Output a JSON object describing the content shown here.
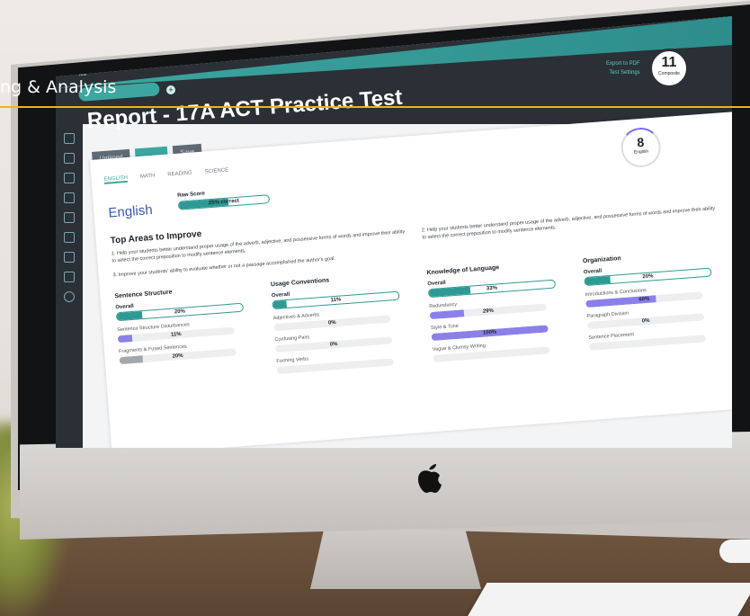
{
  "overlay": {
    "title": "ng & Analysis"
  },
  "app": {
    "test_label": "Test",
    "report_title": "Report - 17A ACT Practice Test",
    "buttons": [
      "Untimed",
      "",
      "Save"
    ],
    "export_pdf": "Export to PDF",
    "test_settings": "Test Settings",
    "composite": {
      "value": "11",
      "label": "Composite"
    }
  },
  "tabs": [
    "ENGLISH",
    "MATH",
    "READING",
    "SCIENCE"
  ],
  "section": {
    "title": "English",
    "score": {
      "value": "8",
      "label": "English"
    },
    "raw_score_label": "Raw Score",
    "raw_score_pct": "25% correct",
    "raw_score_fraction": 0.25
  },
  "top_areas": {
    "title": "Top Areas to Improve",
    "items": [
      "1. Help your students better understand proper usage of the adverb, adjective, and possessive forms of words and improve their ability to select the correct preposition to modify sentence elements.",
      "2. Help your students better understand proper usage of the adverb, adjective, and possessive forms of words and improve their ability to select the correct preposition to modify sentence elements.",
      "3. Improve your students' ability to evaluate whether or not a passage accomplished the author's goal."
    ]
  },
  "categories": [
    {
      "title": "Sentence Structure",
      "overall_label": "Overall",
      "overall": "20%",
      "overall_fraction": 0.2,
      "items": [
        {
          "label": "Sentence Structure Disturbances",
          "value": "11%",
          "fraction": 0.11,
          "tone": "purple"
        },
        {
          "label": "Fragments & Fused Sentences",
          "value": "20%",
          "fraction": 0.2,
          "tone": "grey"
        }
      ]
    },
    {
      "title": "Usage Conventions",
      "overall_label": "Overall",
      "overall": "11%",
      "overall_fraction": 0.11,
      "items": [
        {
          "label": "Adjectives & Adverbs",
          "value": "0%",
          "fraction": 0,
          "tone": "purple"
        },
        {
          "label": "Confusing Pairs",
          "value": "0%",
          "fraction": 0,
          "tone": "purple"
        },
        {
          "label": "Forming Verbs",
          "value": "",
          "fraction": 0,
          "tone": "purple"
        }
      ]
    },
    {
      "title": "Knowledge of Language",
      "overall_label": "Overall",
      "overall": "33%",
      "overall_fraction": 0.33,
      "items": [
        {
          "label": "Redundancy",
          "value": "29%",
          "fraction": 0.29,
          "tone": "purple"
        },
        {
          "label": "Style & Tone",
          "value": "100%",
          "fraction": 1.0,
          "tone": "purple"
        },
        {
          "label": "Vague & Clumsy Writing",
          "value": "",
          "fraction": 0,
          "tone": "purple"
        }
      ]
    },
    {
      "title": "Organization",
      "overall_label": "Overall",
      "overall": "20%",
      "overall_fraction": 0.2,
      "items": [
        {
          "label": "Introductions & Conclusions",
          "value": "60%",
          "fraction": 0.6,
          "tone": "purple"
        },
        {
          "label": "Paragraph Division",
          "value": "0%",
          "fraction": 0,
          "tone": "purple"
        },
        {
          "label": "Sentence Placement",
          "value": "",
          "fraction": 0,
          "tone": "purple"
        }
      ]
    }
  ]
}
